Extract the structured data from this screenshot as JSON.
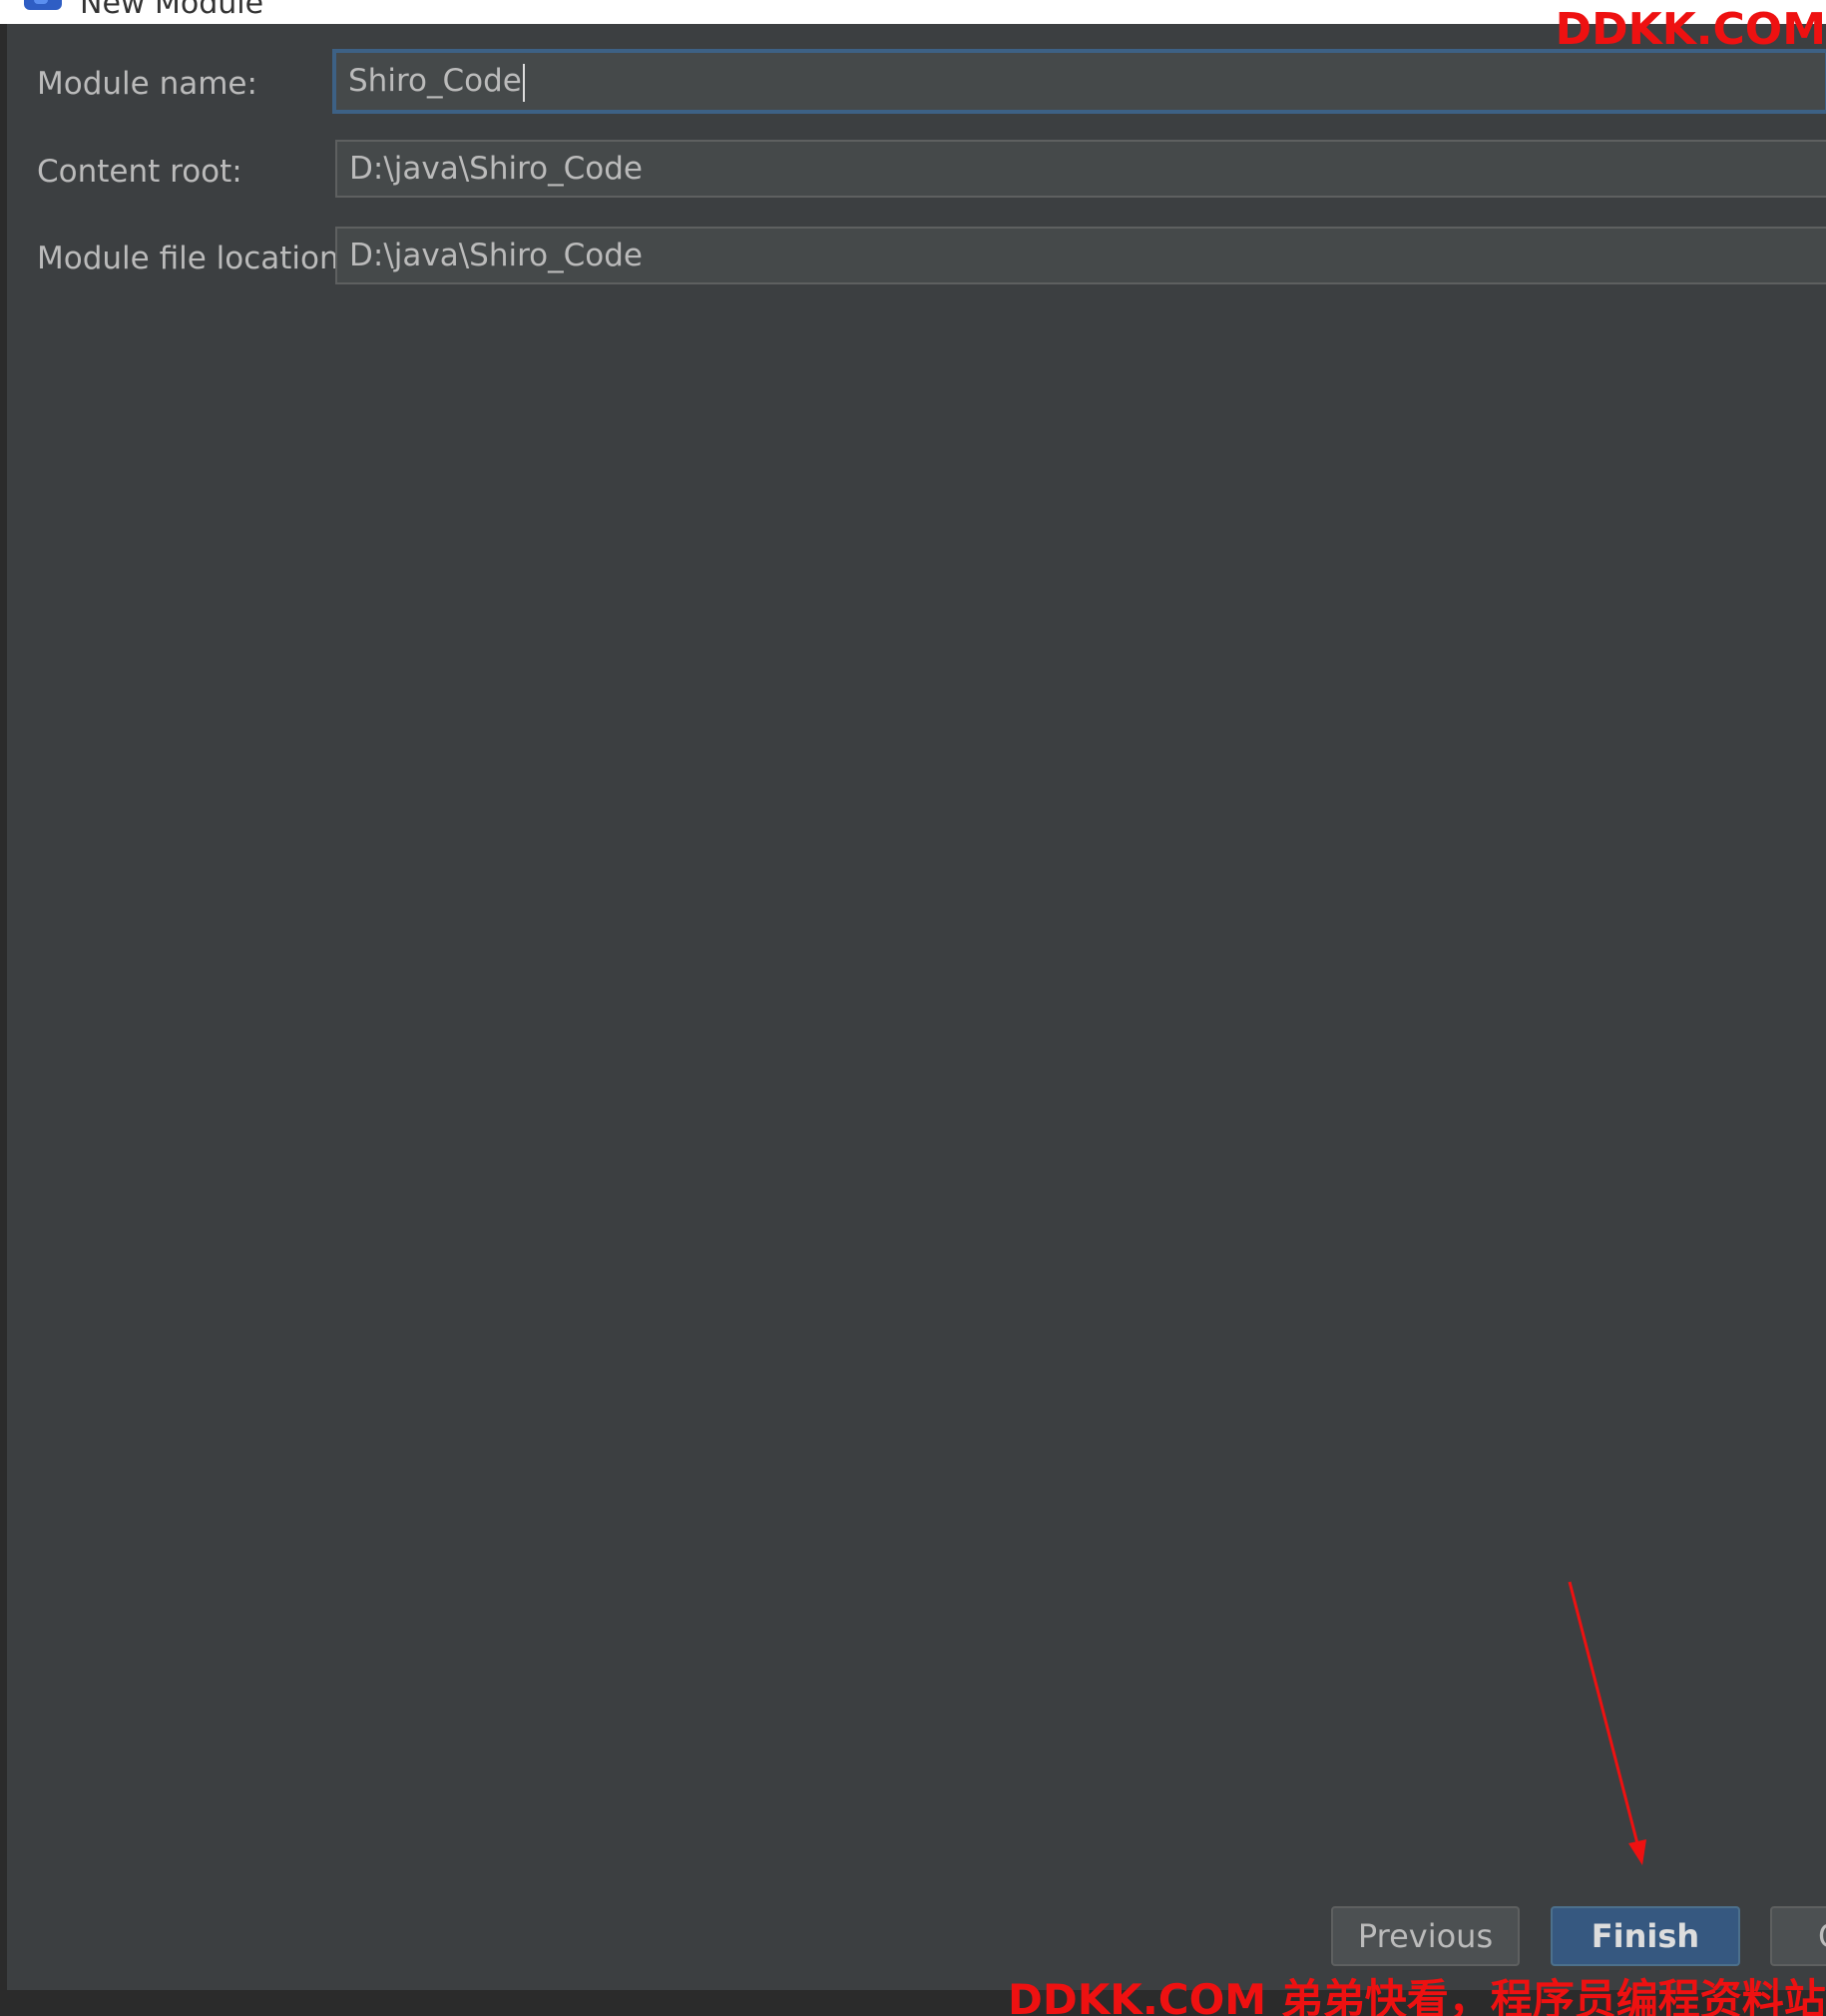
{
  "dialog": {
    "title": "New Module"
  },
  "form": {
    "module_name_label": "Module name:",
    "module_name_value": "Shiro_Code",
    "content_root_label": "Content root:",
    "content_root_value": "D:\\java\\Shiro_Code",
    "module_file_location_label": "Module file location:",
    "module_file_location_value": "D:\\java\\Shiro_Code"
  },
  "buttons": {
    "previous_label": "Previous",
    "finish_label": "Finish",
    "cancel_label": "C"
  },
  "watermark": {
    "top": "DDKK.COM",
    "bottom": "DDKK.COM 弟弟快看，程序员编程资料站"
  },
  "colors": {
    "dialog_background": "#3c3f41",
    "field_background": "#45494a",
    "focus_border": "#3d6185",
    "primary_button": "#365880",
    "annotation_red": "#ee1111"
  },
  "icons": {
    "app": "intellij-app-icon",
    "annotation": "red-arrow-pointing-to-finish"
  }
}
